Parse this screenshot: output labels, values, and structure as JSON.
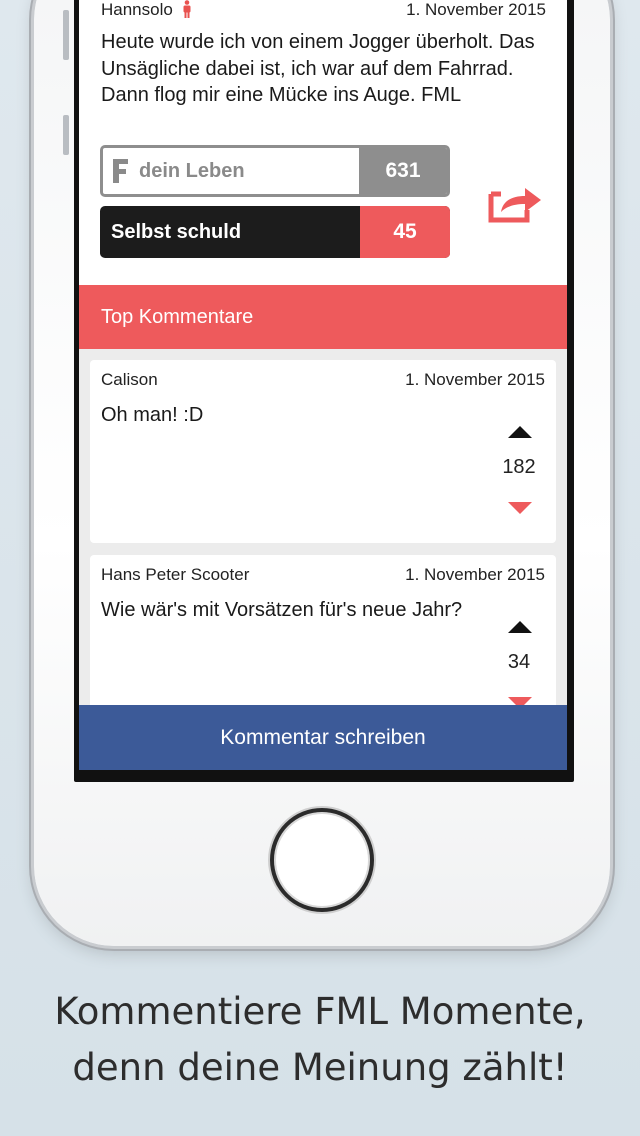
{
  "post": {
    "author": "Hannsolo",
    "date": "1. November 2015",
    "text": "Heute wurde ich von einem Jogger überholt. Das Unsägliche dabei ist, ich war auf dem Fahrrad. Dann flog mir eine Mücke ins Auge. FML",
    "vote_yes_label": "dein Leben",
    "vote_yes_count": "631",
    "vote_no_label": "Selbst schuld",
    "vote_no_count": "45"
  },
  "comments_header": "Top Kommentare",
  "comments": [
    {
      "author": "Calison",
      "date": "1. November 2015",
      "text": "Oh man! :D",
      "score": "182"
    },
    {
      "author": "Hans Peter Scooter",
      "date": "1. November 2015",
      "text": "Wie wär's mit Vorsätzen für's neue Jahr?",
      "score": "34"
    }
  ],
  "write_comment_label": "Kommentar schreiben",
  "caption_line1": "Kommentiere FML Momente,",
  "caption_line2": "denn deine Meinung zählt!",
  "colors": {
    "accent_red": "#ee5a5c",
    "button_blue": "#3c5a98",
    "dark": "#1c1c1c",
    "grey": "#8e8e8e"
  },
  "icons": [
    "person-icon",
    "fml-f-logo",
    "share-icon",
    "upvote-icon",
    "downvote-icon",
    "home-button"
  ]
}
